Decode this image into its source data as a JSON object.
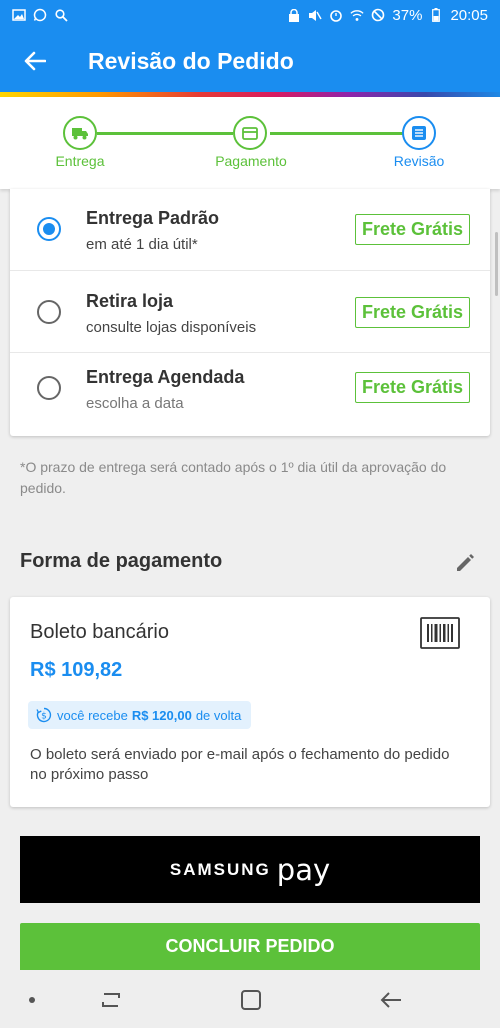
{
  "status_bar": {
    "battery": "37%",
    "time": "20:05"
  },
  "header": {
    "title": "Revisão do Pedido"
  },
  "stepper": {
    "steps": [
      {
        "label": "Entrega",
        "icon": "truck-icon",
        "state": "done"
      },
      {
        "label": "Pagamento",
        "icon": "card-icon",
        "state": "done"
      },
      {
        "label": "Revisão",
        "icon": "document-icon",
        "state": "active"
      }
    ]
  },
  "delivery": {
    "options": [
      {
        "title": "Entrega Padrão",
        "subtitle": "em até 1 dia útil*",
        "badge": "Frete Grátis",
        "selected": true
      },
      {
        "title": "Retira loja",
        "subtitle": "consulte lojas disponíveis",
        "badge": "Frete Grátis",
        "selected": false
      },
      {
        "title": "Entrega Agendada",
        "subtitle": "escolha a data",
        "badge": "Frete Grátis",
        "selected": false
      }
    ],
    "note": "*O prazo de entrega será contado após o 1º dia útil da aprovação do pedido."
  },
  "payment": {
    "section_title": "Forma de pagamento",
    "method": "Boleto bancário",
    "price": "R$ 109,82",
    "cashback_prefix": "você recebe",
    "cashback_amount": "R$ 120,00",
    "cashback_suffix": "de volta",
    "description": "O boleto será enviado por e-mail após o fechamento do pedido no próximo passo"
  },
  "samsung_pay": {
    "brand": "SAMSUNG",
    "pay": "pay"
  },
  "actions": {
    "conclude_label": "CONCLUIR PEDIDO"
  },
  "colors": {
    "primary": "#1a8df0",
    "success": "#5cc13a"
  }
}
